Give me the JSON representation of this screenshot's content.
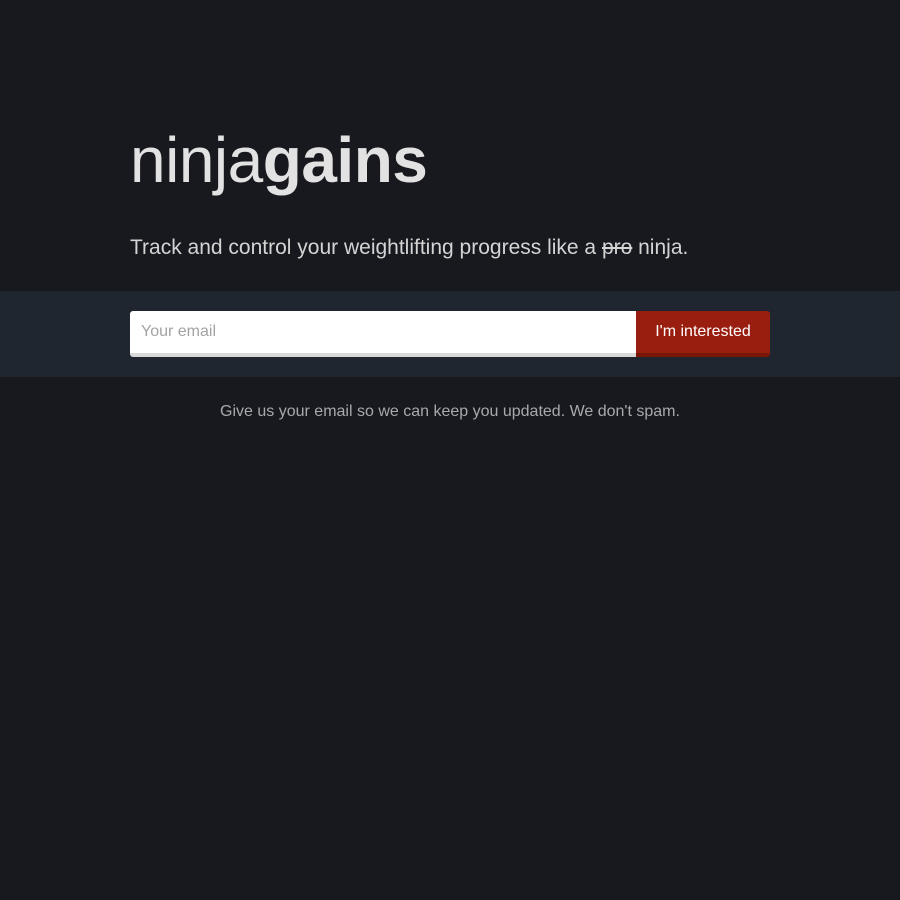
{
  "brand": {
    "name_light": "ninja",
    "name_bold": "gains"
  },
  "tagline": {
    "before": "Track and control your weightlifting progress like a ",
    "struck": "pro",
    "after": " ninja."
  },
  "signup": {
    "email_placeholder": "Your email",
    "email_value": "",
    "button_label": "I'm interested"
  },
  "note": "Give us your email so we can keep you updated. We don't spam.",
  "colors": {
    "background": "#17191e",
    "band": "#1f2630",
    "accent": "#9a1e0f",
    "text": "#e2e2e2",
    "muted": "#a7a9ad"
  }
}
